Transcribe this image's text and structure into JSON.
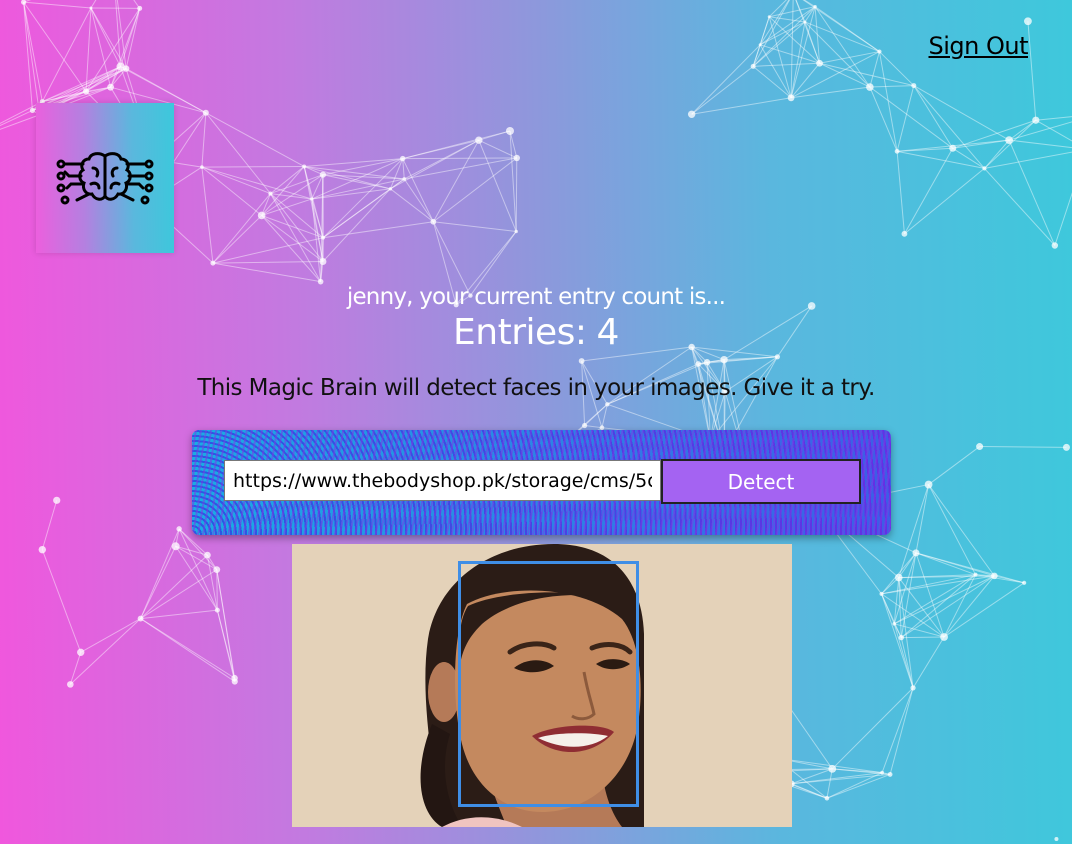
{
  "nav": {
    "sign_out_label": "Sign Out"
  },
  "logo": {
    "icon": "brain-circuit-icon"
  },
  "rank": {
    "message": "jenny, your current entry count is...",
    "entries_label": "Entries:",
    "entries_count": "4"
  },
  "image_link_form": {
    "description": "This Magic Brain will detect faces in your images. Give it a try.",
    "url_value": "https://www.thebodyshop.pk/storage/cms/5c",
    "detect_label": "Detect"
  },
  "face_recognition": {
    "image_icon": "smiling-woman-photo",
    "face_box_color": "#3f8ee6"
  },
  "colors": {
    "gradient_left": "#f057dd",
    "gradient_right": "#3ec8dc",
    "button": "#a463f2"
  }
}
